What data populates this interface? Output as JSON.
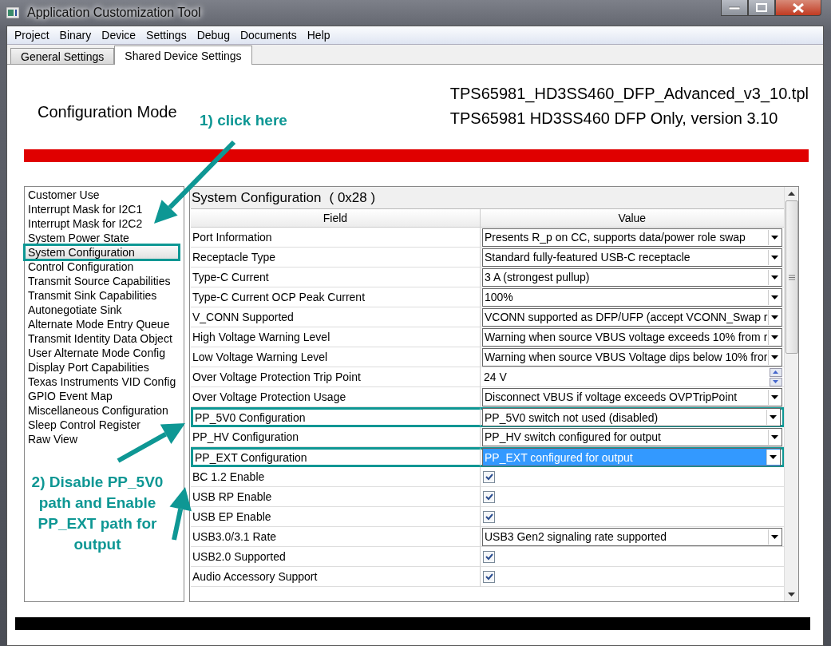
{
  "window": {
    "title": "Application Customization Tool"
  },
  "menu": [
    "Project",
    "Binary",
    "Device",
    "Settings",
    "Debug",
    "Documents",
    "Help"
  ],
  "tabs": [
    {
      "label": "General Settings",
      "selected": false
    },
    {
      "label": "Shared Device Settings",
      "selected": true
    }
  ],
  "header": {
    "mode": "Configuration Mode",
    "file": "TPS65981_HD3SS460_DFP_Advanced_v3_10.tpl",
    "description": "TPS65981 HD3SS460 DFP Only, version 3.10"
  },
  "sidebar": {
    "items": [
      {
        "label": "Customer Use",
        "selected": false
      },
      {
        "label": "Interrupt Mask for I2C1",
        "selected": false
      },
      {
        "label": "Interrupt Mask for I2C2",
        "selected": false
      },
      {
        "label": "System Power State",
        "selected": false
      },
      {
        "label": "System Configuration",
        "selected": true
      },
      {
        "label": "Control Configuration",
        "selected": false
      },
      {
        "label": "Transmit Source Capabilities",
        "selected": false
      },
      {
        "label": "Transmit Sink Capabilities",
        "selected": false
      },
      {
        "label": "Autonegotiate Sink",
        "selected": false
      },
      {
        "label": "Alternate Mode Entry Queue",
        "selected": false
      },
      {
        "label": "Transmit Identity Data Object",
        "selected": false
      },
      {
        "label": "User Alternate Mode Config",
        "selected": false
      },
      {
        "label": "Display Port Capabilities",
        "selected": false
      },
      {
        "label": "Texas Instruments VID Config",
        "selected": false
      },
      {
        "label": "GPIO Event Map",
        "selected": false
      },
      {
        "label": "Miscellaneous Configuration",
        "selected": false
      },
      {
        "label": "Sleep Control Register",
        "selected": false
      },
      {
        "label": "Raw View",
        "selected": false
      }
    ]
  },
  "panel": {
    "title": "System Configuration",
    "register": "( 0x28 )"
  },
  "table": {
    "columns": [
      "Field",
      "Value"
    ],
    "rows": [
      {
        "kind": "select",
        "field": "Port Information",
        "value": "Presents R_p on CC, supports data/power role swap",
        "selected": false,
        "highlighted": false
      },
      {
        "kind": "select",
        "field": "Receptacle Type",
        "value": "Standard fully-featured USB-C receptacle",
        "selected": false,
        "highlighted": false
      },
      {
        "kind": "select",
        "field": "Type-C Current",
        "value": "3 A (strongest pullup)",
        "selected": false,
        "highlighted": false
      },
      {
        "kind": "select",
        "field": "Type-C Current OCP Peak Current",
        "value": "100%",
        "selected": false,
        "highlighted": false
      },
      {
        "kind": "select",
        "field": "V_CONN Supported",
        "value": "VCONN supported as DFP/UFP (accept VCONN_Swap r",
        "selected": false,
        "highlighted": false
      },
      {
        "kind": "select",
        "field": "High Voltage Warning Level",
        "value": "Warning when source VBUS voltage exceeds 10% from r",
        "selected": false,
        "highlighted": false
      },
      {
        "kind": "select",
        "field": "Low Voltage Warning Level",
        "value": "Warning when source VBUS Voltage dips below 10% fror",
        "selected": false,
        "highlighted": false
      },
      {
        "kind": "spin",
        "field": "Over Voltage Protection Trip Point",
        "value": "24 V",
        "highlighted": false
      },
      {
        "kind": "select",
        "field": "Over Voltage Protection Usage",
        "value": "Disconnect VBUS if voltage exceeds OVPTripPoint",
        "selected": false,
        "highlighted": false
      },
      {
        "kind": "select",
        "field": "PP_5V0 Configuration",
        "value": "PP_5V0 switch not used (disabled)",
        "selected": false,
        "highlighted": true
      },
      {
        "kind": "select",
        "field": "PP_HV Configuration",
        "value": "PP_HV switch configured for output",
        "selected": false,
        "highlighted": false
      },
      {
        "kind": "select",
        "field": "PP_EXT Configuration",
        "value": "PP_EXT configured for output",
        "selected": true,
        "highlighted": true
      },
      {
        "kind": "checkbox",
        "field": "BC 1.2 Enable",
        "checked": true
      },
      {
        "kind": "checkbox",
        "field": "USB RP Enable",
        "checked": true
      },
      {
        "kind": "checkbox",
        "field": "USB EP Enable",
        "checked": true
      },
      {
        "kind": "select",
        "field": "USB3.0/3.1 Rate",
        "value": "USB3 Gen2 signaling rate supported",
        "selected": false,
        "highlighted": false
      },
      {
        "kind": "checkbox",
        "field": "USB2.0 Supported",
        "checked": true
      },
      {
        "kind": "checkbox",
        "field": "Audio Accessory Support",
        "checked": true
      }
    ]
  },
  "annotations": [
    "1) click here",
    "2) Disable PP_5V0 path and Enable PP_EXT path for output"
  ]
}
